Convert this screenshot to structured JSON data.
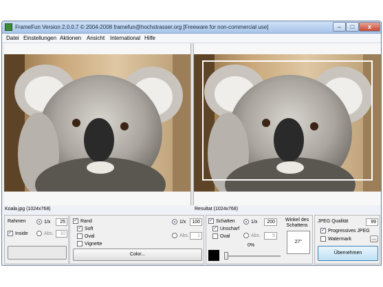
{
  "title": "FrameFun Version 2.0.0.7 © 2004-2008 framefun@hochstrasser.org [Freeware for non-commercial use]",
  "window_buttons": {
    "minimize": "–",
    "maximize": "□",
    "close": "x"
  },
  "menu": [
    "Datei",
    "Einstellungen",
    "Aktionen",
    "Ansicht",
    "International",
    "Hilfe"
  ],
  "captions": {
    "original": "Koala.jpg (1024x768)",
    "result": "Resultat (1024x768)"
  },
  "rahmen": {
    "label": "Rahmen",
    "inside_label": "Inside",
    "inside_checked": true,
    "ratio_label": "1/x",
    "ratio_selected": true,
    "ratio_value": "25",
    "abs_label": "Abs.",
    "abs_value": "10"
  },
  "rand": {
    "label": "Rand",
    "checked": true,
    "options": [
      {
        "label": "Soft",
        "checked": true
      },
      {
        "label": "Oval",
        "checked": false
      },
      {
        "label": "Vignette",
        "checked": false
      }
    ],
    "ratio_label": "1/x",
    "ratio_value": "100",
    "abs_label": "Abs.",
    "abs_value": "1",
    "color_button": "Color..."
  },
  "schatten": {
    "label": "Schatten",
    "checked": true,
    "options": [
      {
        "label": "Unscharf",
        "checked": true
      },
      {
        "label": "Oval",
        "checked": false
      }
    ],
    "ratio_label": "1/x",
    "ratio_value": "200",
    "abs_label": "Abs.",
    "abs_value": "5",
    "percent": "0%",
    "slider_level": 0,
    "angle_label": "Winkel des Schattens",
    "angle_value": "27°",
    "color": "#000000"
  },
  "jpeg": {
    "quality_label": "JPEG Qualität",
    "quality_value": "99",
    "progressive_label": "Progressives JPEG",
    "progressive_checked": true,
    "watermark_label": "Watermark",
    "watermark_checked": false,
    "more_button": "...",
    "apply_button": "Übernehmen"
  },
  "colors": {
    "accent": "#1e4f9f",
    "titlebar": "#a8c4ea",
    "frame": "#ffffff"
  }
}
